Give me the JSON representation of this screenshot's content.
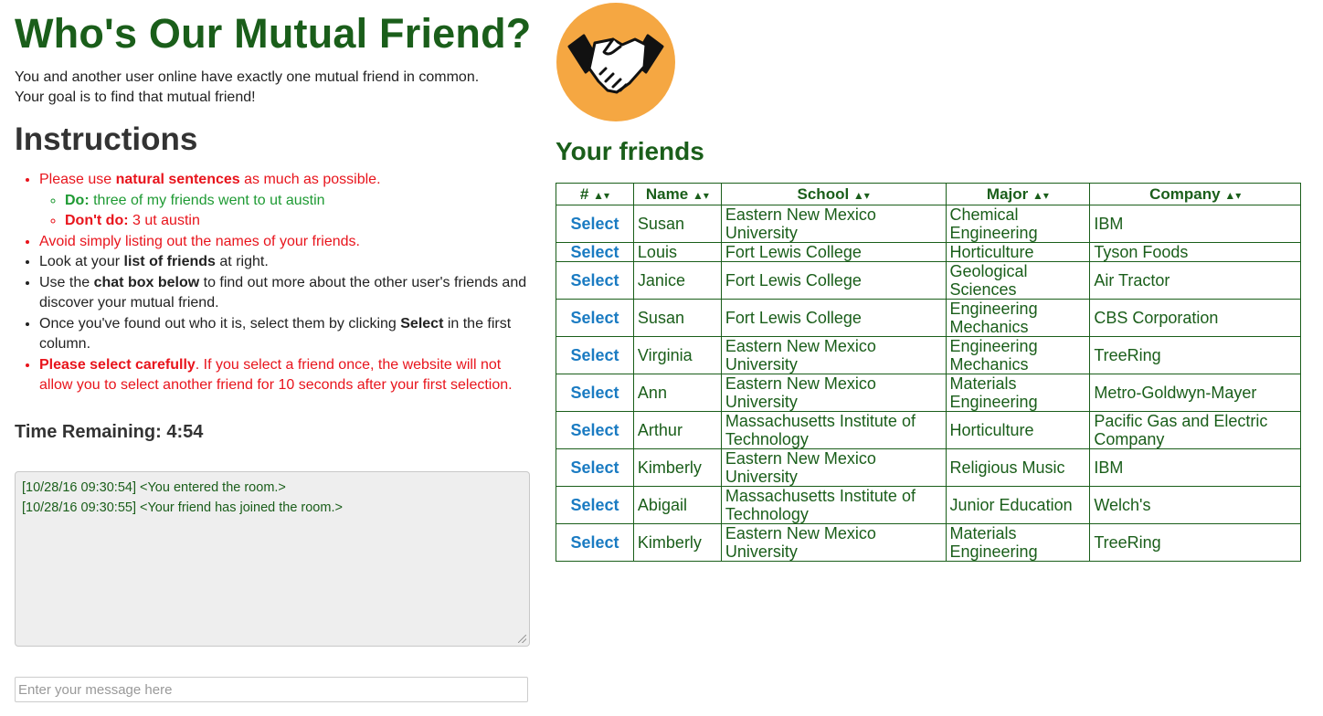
{
  "header": {
    "title": "Who's Our Mutual Friend?",
    "intro_line1": "You and another user online have exactly one mutual friend in common.",
    "intro_line2": "Your goal is to find that mutual friend!"
  },
  "instructions": {
    "heading": "Instructions",
    "i1_pre": "Please use ",
    "i1_bold": "natural sentences",
    "i1_post": " as much as possible.",
    "do_label": "Do:",
    "do_text": " three of my friends went to ut austin",
    "dont_label": "Don't do:",
    "dont_text": " 3 ut austin",
    "i2": "Avoid simply listing out the names of your friends.",
    "i3_pre": "Look at your ",
    "i3_bold": "list of friends",
    "i3_post": " at right.",
    "i4_pre": "Use the ",
    "i4_bold": "chat box below",
    "i4_post": " to find out more about the other user's friends and discover your mutual friend.",
    "i5_pre": "Once you've found out who it is, select them by clicking ",
    "i5_bold": "Select",
    "i5_post": " in the first column.",
    "i6_bold": "Please select carefully",
    "i6_post": ". If you select a friend once, the website will not allow you to select another friend for 10 seconds after your first selection."
  },
  "timer": {
    "label": "Time Remaining: 4:54"
  },
  "chat": {
    "messages": [
      "[10/28/16 09:30:54] <You entered the room.>",
      "[10/28/16 09:30:55] <Your friend has joined the room.>"
    ],
    "input_placeholder": "Enter your message here"
  },
  "friends": {
    "title": "Your friends",
    "columns": [
      "#",
      "Name",
      "School",
      "Major",
      "Company"
    ],
    "sort_glyph": "▲▾",
    "select_label": "Select",
    "rows": [
      {
        "name": "Susan",
        "school": "Eastern New Mexico University",
        "major": "Chemical Engineering",
        "company": "IBM"
      },
      {
        "name": "Louis",
        "school": "Fort Lewis College",
        "major": "Horticulture",
        "company": "Tyson Foods"
      },
      {
        "name": "Janice",
        "school": "Fort Lewis College",
        "major": "Geological Sciences",
        "company": "Air Tractor"
      },
      {
        "name": "Susan",
        "school": "Fort Lewis College",
        "major": "Engineering Mechanics",
        "company": "CBS Corporation"
      },
      {
        "name": "Virginia",
        "school": "Eastern New Mexico University",
        "major": "Engineering Mechanics",
        "company": "TreeRing"
      },
      {
        "name": "Ann",
        "school": "Eastern New Mexico University",
        "major": "Materials Engineering",
        "company": "Metro-Goldwyn-Mayer"
      },
      {
        "name": "Arthur",
        "school": "Massachusetts Institute of Technology",
        "major": "Horticulture",
        "company": "Pacific Gas and Electric Company"
      },
      {
        "name": "Kimberly",
        "school": "Eastern New Mexico University",
        "major": "Religious Music",
        "company": "IBM"
      },
      {
        "name": "Abigail",
        "school": "Massachusetts Institute of Technology",
        "major": "Junior Education",
        "company": "Welch's"
      },
      {
        "name": "Kimberly",
        "school": "Eastern New Mexico University",
        "major": "Materials Engineering",
        "company": "TreeRing"
      }
    ]
  },
  "logo": {
    "icon": "handshake-icon",
    "bg_color": "#f5a742"
  }
}
